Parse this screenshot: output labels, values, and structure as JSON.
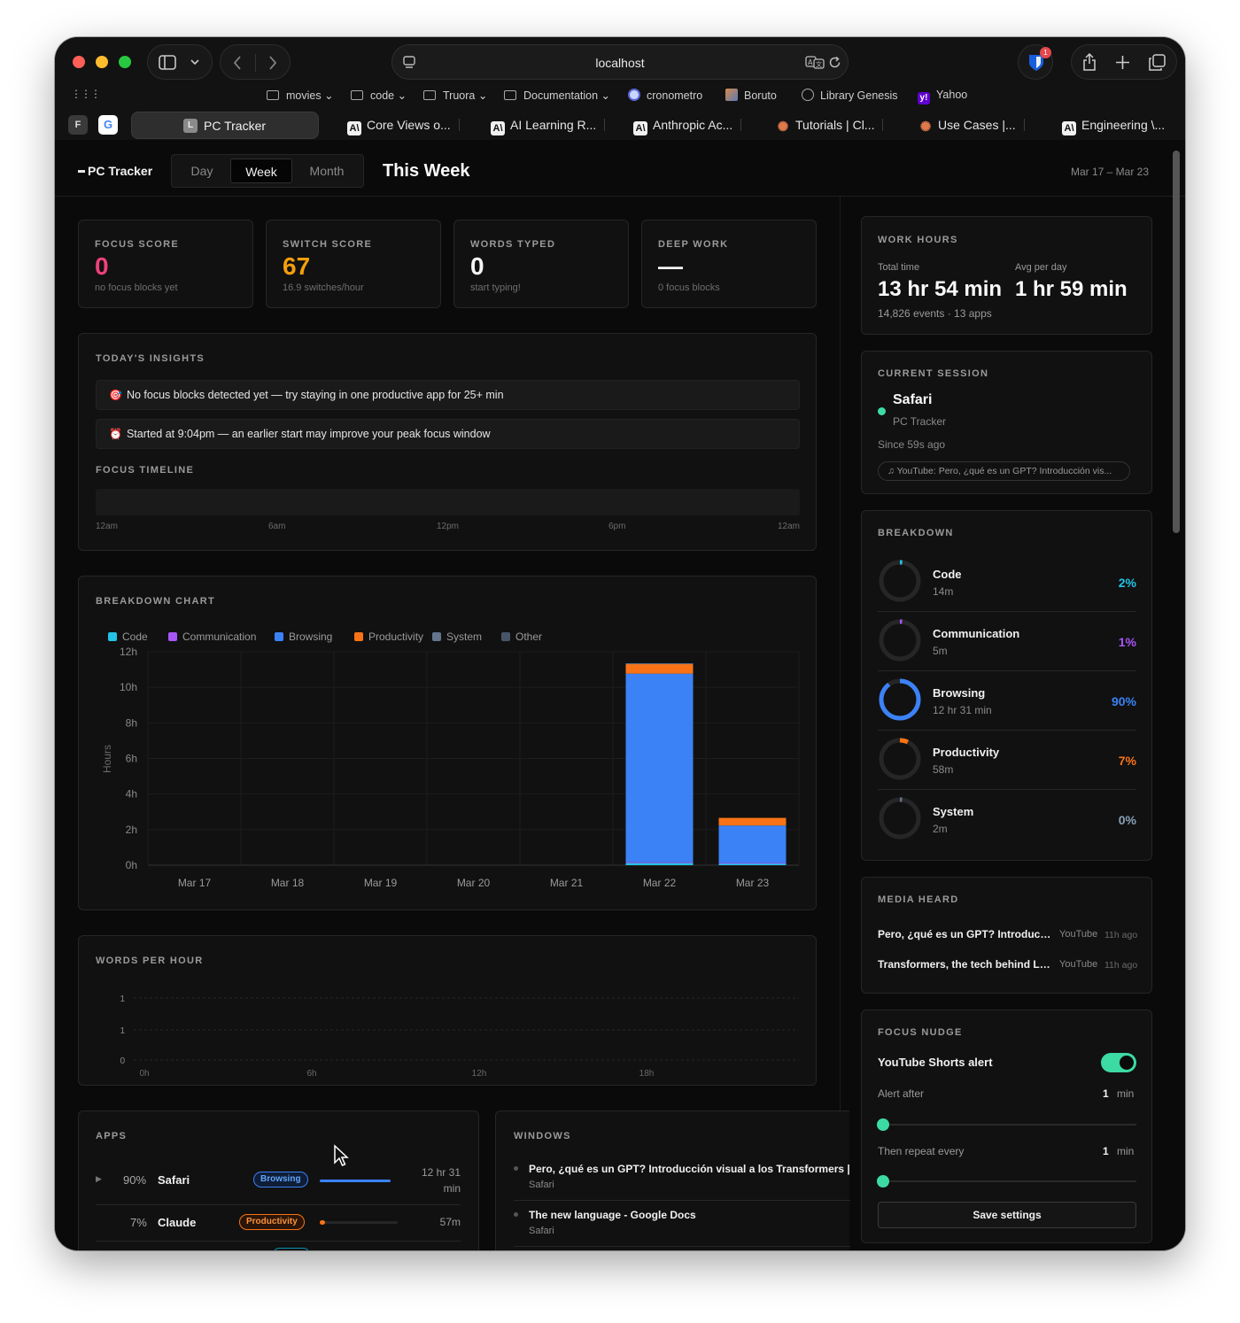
{
  "browser": {
    "url": "localhost",
    "shield_badge": "1",
    "bookmarks": [
      {
        "label": "movies",
        "icon": "folder-icon",
        "menu": true
      },
      {
        "label": "code",
        "icon": "folder-icon",
        "menu": true
      },
      {
        "label": "Truora",
        "icon": "folder-icon",
        "menu": true
      },
      {
        "label": "Documentation",
        "icon": "folder-icon",
        "menu": true
      },
      {
        "label": "cronometro",
        "icon": "clock-favicon",
        "menu": false
      },
      {
        "label": "Boruto",
        "icon": "image-favicon",
        "menu": false
      },
      {
        "label": "Library Genesis",
        "icon": "globe-icon",
        "menu": false
      },
      {
        "label": "Yahoo",
        "icon": "yahoo-favicon",
        "menu": false
      }
    ],
    "pinned_tabs": [
      "F",
      "G"
    ],
    "active_tab": {
      "label": "PC Tracker",
      "letter": "L"
    },
    "tabs": [
      "Core Views o...",
      "AI Learning R...",
      "Anthropic Ac...",
      "Tutorials | Cl...",
      "Use Cases |...",
      "Engineering \\..."
    ]
  },
  "app": {
    "brand": "PC Tracker",
    "periods": [
      "Day",
      "Week",
      "Month"
    ],
    "active_period": "Week",
    "page_title": "This Week",
    "date_range": "Mar 17 – Mar 23"
  },
  "stats": [
    {
      "label": "FOCUS SCORE",
      "value": "0",
      "sub": "no focus blocks yet",
      "color": "#f0407a"
    },
    {
      "label": "SWITCH SCORE",
      "value": "67",
      "sub": "16.9 switches/hour",
      "color": "#f59e0b"
    },
    {
      "label": "WORDS TYPED",
      "value": "0",
      "sub": "start typing!",
      "color": "#f5f5f5"
    },
    {
      "label": "DEEP WORK",
      "value": "—",
      "sub": "0 focus blocks",
      "color": "#f5f5f5"
    }
  ],
  "insights": {
    "title": "TODAY'S INSIGHTS",
    "items": [
      {
        "icon": "🎯",
        "text": "No focus blocks detected yet — try staying in one productive app for 25+ min"
      },
      {
        "icon": "⏰",
        "text": "Started at 9:04pm — an earlier start may improve your peak focus window"
      }
    ],
    "timeline_title": "FOCUS TIMELINE",
    "timeline_ticks": [
      "12am",
      "6am",
      "12pm",
      "6pm",
      "12am"
    ]
  },
  "breakdown_chart": {
    "title": "BREAKDOWN CHART",
    "legend": [
      {
        "name": "Code",
        "color": "#22c3e6"
      },
      {
        "name": "Communication",
        "color": "#a855f7"
      },
      {
        "name": "Browsing",
        "color": "#3b82f6"
      },
      {
        "name": "Productivity",
        "color": "#f97316"
      },
      {
        "name": "System",
        "color": "#64748b"
      },
      {
        "name": "Other",
        "color": "#475569"
      }
    ]
  },
  "chart_data": [
    {
      "type": "bar",
      "stacked": true,
      "title": "BREAKDOWN CHART",
      "ylabel": "Hours",
      "ylim": [
        0,
        12
      ],
      "yticks": [
        "0h",
        "2h",
        "4h",
        "6h",
        "8h",
        "10h",
        "12h"
      ],
      "categories": [
        "Mar 17",
        "Mar 18",
        "Mar 19",
        "Mar 20",
        "Mar 21",
        "Mar 22",
        "Mar 23"
      ],
      "series": [
        {
          "name": "Code",
          "color": "#22c3e6",
          "values": [
            0,
            0,
            0,
            0,
            0,
            0.12,
            0.1
          ]
        },
        {
          "name": "Communication",
          "color": "#a855f7",
          "values": [
            0,
            0,
            0,
            0,
            0,
            0.05,
            0.03
          ]
        },
        {
          "name": "Browsing",
          "color": "#3b82f6",
          "values": [
            0,
            0,
            0,
            0,
            0,
            10.6,
            2.1
          ]
        },
        {
          "name": "Productivity",
          "color": "#f97316",
          "values": [
            0,
            0,
            0,
            0,
            0,
            0.55,
            0.43
          ]
        },
        {
          "name": "System",
          "color": "#64748b",
          "values": [
            0,
            0,
            0,
            0,
            0,
            0.03,
            0.0
          ]
        },
        {
          "name": "Other",
          "color": "#475569",
          "values": [
            0,
            0,
            0,
            0,
            0,
            0,
            0
          ]
        }
      ],
      "grid": true,
      "legend_position": "top-left"
    },
    {
      "type": "line",
      "title": "WORDS PER HOUR",
      "x_ticks": [
        "0h",
        "6h",
        "12h",
        "18h"
      ],
      "y_ticks": [
        "0",
        "1",
        "1"
      ],
      "values": []
    }
  ],
  "words_per_hour": {
    "title": "WORDS PER HOUR"
  },
  "apps": {
    "title": "APPS",
    "rows": [
      {
        "pct": "90%",
        "name": "Safari",
        "category": "Browsing",
        "time_a": "12 hr 31",
        "time_b": "min",
        "share": 0.9,
        "color": "#3b82f6"
      },
      {
        "pct": "7%",
        "name": "Claude",
        "category": "Productivity",
        "time_a": "57m",
        "time_b": "",
        "share": 0.07,
        "color": "#f97316"
      }
    ]
  },
  "windows": {
    "title": "WINDOWS",
    "rows": [
      {
        "title": "Pero, ¿qué es un GPT? Introducción visual a los Transformers | C",
        "app": "Safari"
      },
      {
        "title": "The new language - Google Docs",
        "app": "Safari"
      }
    ]
  },
  "work_hours": {
    "title": "WORK HOURS",
    "total_label": "Total time",
    "total": "13 hr 54 min",
    "avg_label": "Avg per day",
    "avg": "1 hr 59 min",
    "sub": "14,826 events · 13 apps"
  },
  "session": {
    "title": "CURRENT SESSION",
    "app": "Safari",
    "window": "PC Tracker",
    "since": "Since 59s ago",
    "media": "♫ YouTube: Pero, ¿qué es un GPT? Introducción vis..."
  },
  "breakdown": {
    "title": "BREAKDOWN",
    "items": [
      {
        "name": "Code",
        "time": "14m",
        "pct": "2%",
        "share": 0.02,
        "color": "#22c3e6"
      },
      {
        "name": "Communication",
        "time": "5m",
        "pct": "1%",
        "share": 0.01,
        "color": "#a855f7"
      },
      {
        "name": "Browsing",
        "time": "12 hr 31 min",
        "pct": "90%",
        "share": 0.9,
        "color": "#3b82f6"
      },
      {
        "name": "Productivity",
        "time": "58m",
        "pct": "7%",
        "share": 0.07,
        "color": "#f97316"
      },
      {
        "name": "System",
        "time": "2m",
        "pct": "0%",
        "share": 0.004,
        "color": "#64748b"
      }
    ]
  },
  "media_heard": {
    "title": "MEDIA HEARD",
    "items": [
      {
        "title": "Pero, ¿qué es un GPT? Introducción visual a los Transformers",
        "source": "YouTube",
        "ago": "11h ago"
      },
      {
        "title": "Transformers, the tech behind LLMs",
        "source": "YouTube",
        "ago": "11h ago"
      }
    ]
  },
  "focus_nudge": {
    "title": "FOCUS NUDGE",
    "toggle_label": "YouTube Shorts alert",
    "toggle_on": true,
    "alert_label": "Alert after",
    "alert_value": "1",
    "alert_unit": "min",
    "repeat_label": "Then repeat every",
    "repeat_value": "1",
    "repeat_unit": "min",
    "save_label": "Save settings"
  }
}
